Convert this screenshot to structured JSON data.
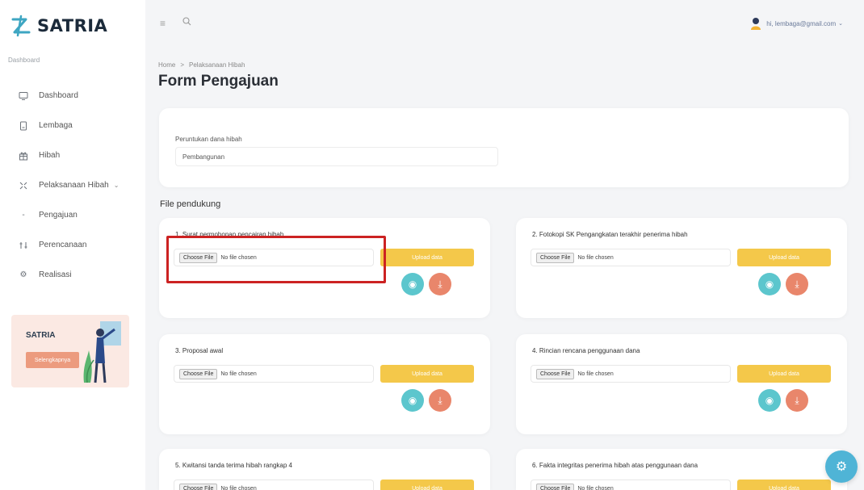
{
  "app": {
    "brand": "SATRIA"
  },
  "sidebar": {
    "section_label": "Dashboard",
    "items": [
      {
        "label": "Dashboard",
        "icon": "monitor-icon"
      },
      {
        "label": "Lembaga",
        "icon": "building-icon"
      },
      {
        "label": "Hibah",
        "icon": "gift-icon"
      },
      {
        "label": "Pelaksanaan Hibah",
        "icon": "expand-icon"
      },
      {
        "label": "Pengajuan",
        "icon": "dash-icon"
      },
      {
        "label": "Perencanaan",
        "icon": "sliders-icon"
      },
      {
        "label": "Realisasi",
        "icon": "gear-icon"
      }
    ],
    "promo": {
      "title": "SATRIA",
      "button": "Selengkapnya"
    }
  },
  "header": {
    "user_email": "hi, lembaga@gmail.com"
  },
  "main": {
    "breadcrumb": [
      "Home",
      "Pelaksanaan Hibah"
    ],
    "breadcrumb_sep": ">",
    "title": "Form Pengajuan",
    "type_field": {
      "label": "Peruntukan dana hibah",
      "value": "Pembangunan"
    },
    "files_label": "File pendukung",
    "choose_file": "Choose File",
    "no_file": "No file chosen",
    "upload_label": "Upload data",
    "documents": [
      {
        "title": "1. Surat permohonan pencairan hibah"
      },
      {
        "title": "2. Fotokopi SK Pengangkatan terakhir penerima hibah"
      },
      {
        "title": "3. Proposal awal"
      },
      {
        "title": "4. Rincian rencana penggunaan dana"
      },
      {
        "title": "5. Kwitansi tanda terima hibah rangkap 4"
      },
      {
        "title": "6. Fakta integritas penerima hibah atas penggunaan dana"
      }
    ]
  },
  "colors": {
    "accent_yellow": "#f4c84a",
    "view_teal": "#5cc6cd",
    "download_orange": "#e9866b",
    "highlight_red": "#cc2222"
  }
}
